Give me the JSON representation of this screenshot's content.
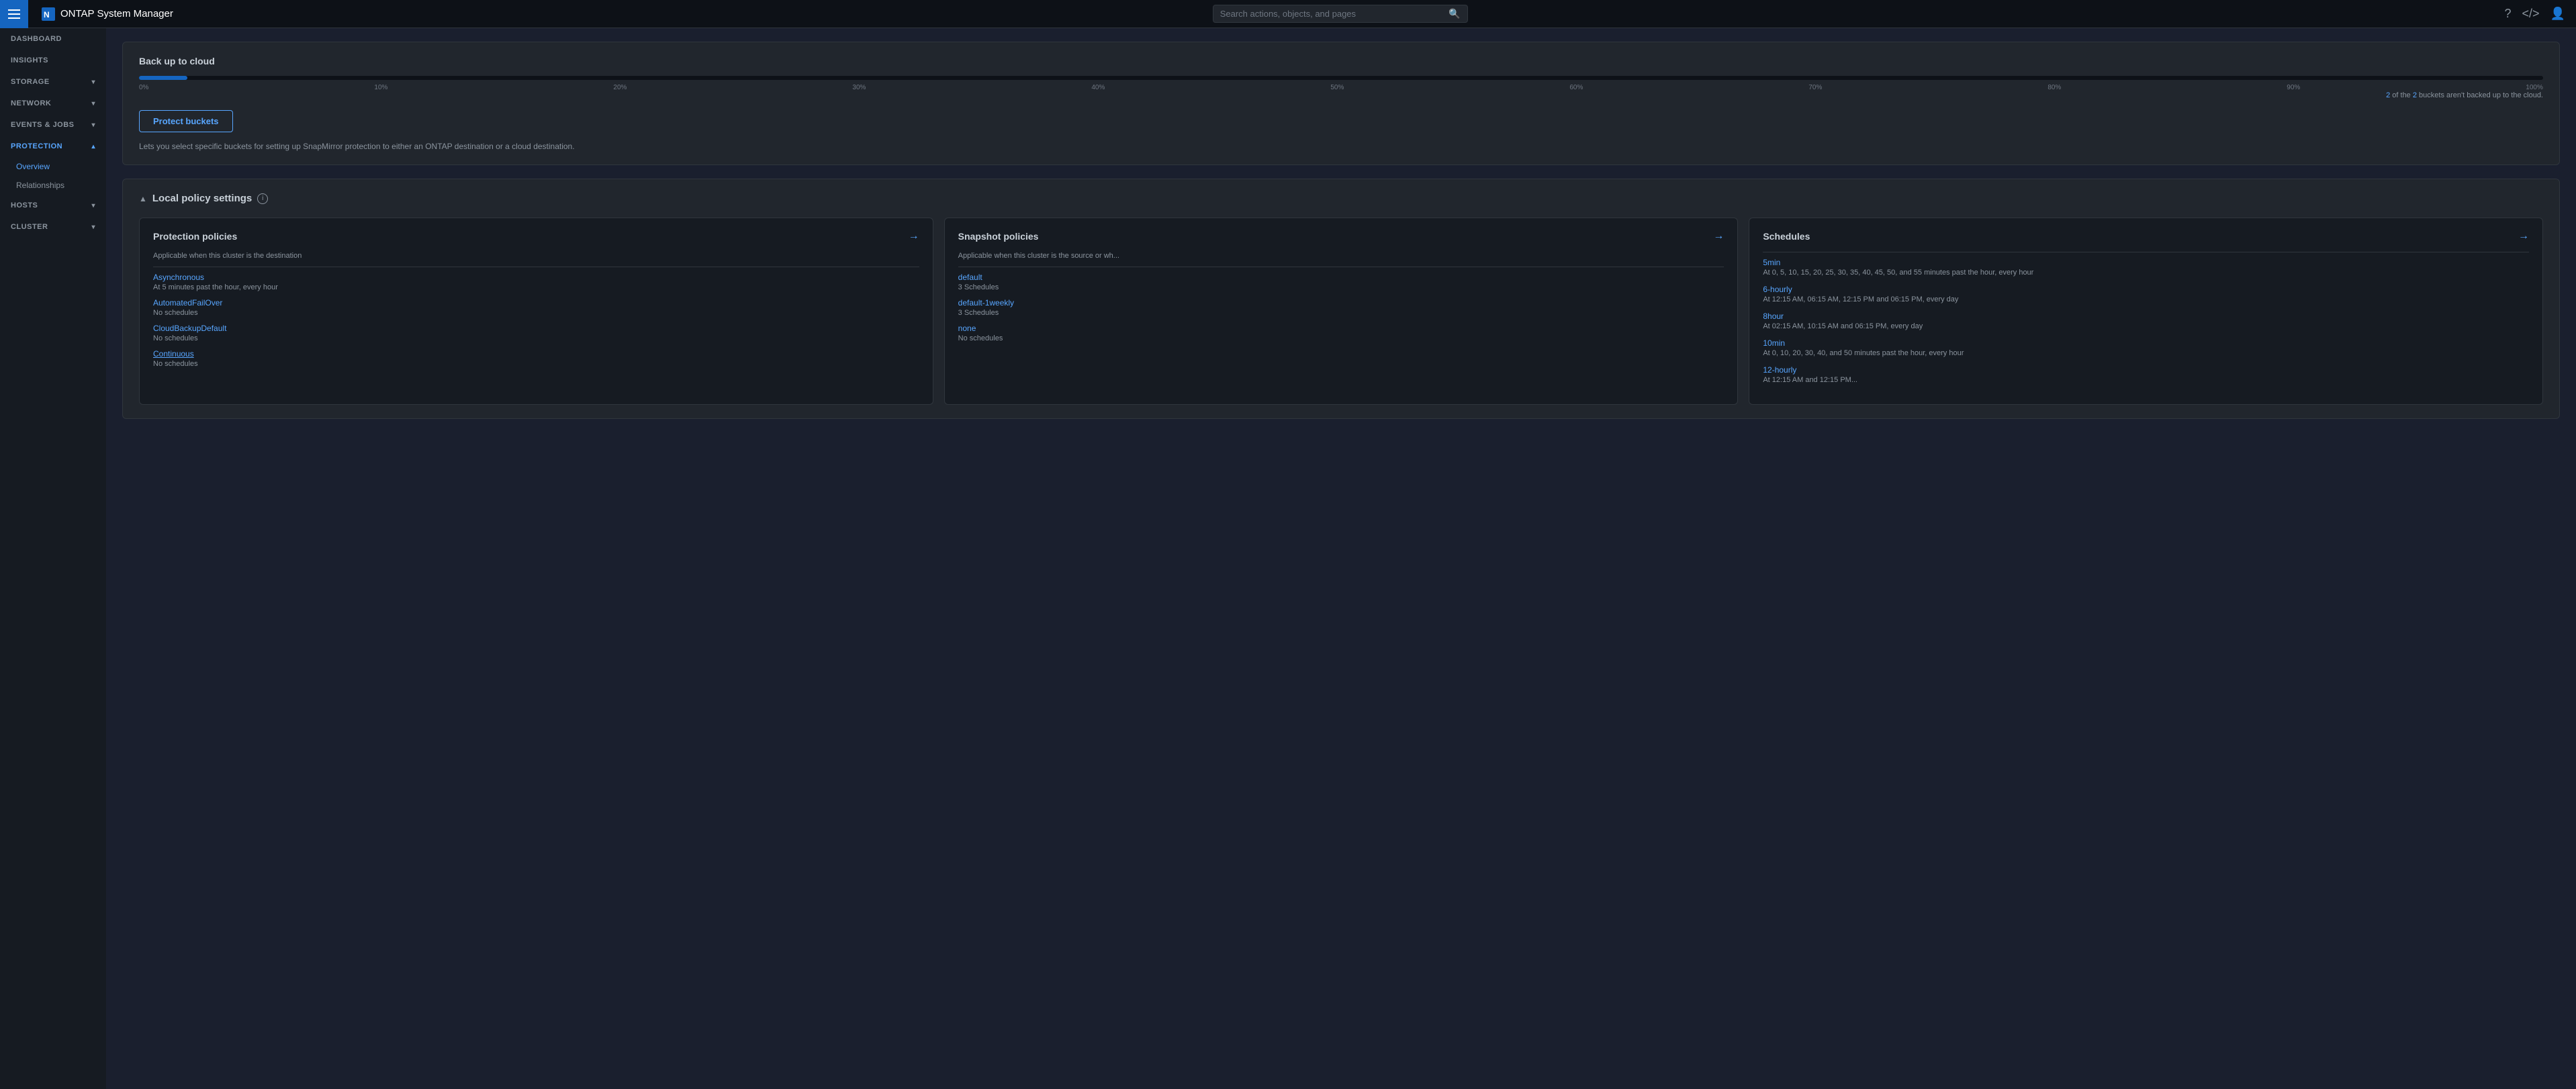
{
  "app": {
    "title": "ONTAP System Manager",
    "search_placeholder": "Search actions, objects, and pages"
  },
  "sidebar": {
    "items": [
      {
        "id": "dashboard",
        "label": "DASHBOARD",
        "has_children": false,
        "active": false
      },
      {
        "id": "insights",
        "label": "INSIGHTS",
        "has_children": false,
        "active": false
      },
      {
        "id": "storage",
        "label": "STORAGE",
        "has_children": true,
        "active": false
      },
      {
        "id": "network",
        "label": "NETWORK",
        "has_children": true,
        "active": false
      },
      {
        "id": "events-jobs",
        "label": "EVENTS & JOBS",
        "has_children": true,
        "active": false
      },
      {
        "id": "protection",
        "label": "PROTECTION",
        "has_children": true,
        "active": true
      }
    ],
    "protection_children": [
      {
        "id": "overview",
        "label": "Overview",
        "active": true
      },
      {
        "id": "relationships",
        "label": "Relationships",
        "active": false
      }
    ],
    "bottom_items": [
      {
        "id": "hosts",
        "label": "HOSTS",
        "has_children": true
      },
      {
        "id": "cluster",
        "label": "CLUSTER",
        "has_children": true
      }
    ]
  },
  "cloud_section": {
    "title": "Back up to cloud",
    "progress_note_prefix": "2 of the",
    "progress_note_count": "2",
    "progress_note_suffix": "buckets aren't backed up to the cloud.",
    "progress_percent": 2,
    "progress_labels": [
      "0%",
      "10%",
      "20%",
      "30%",
      "40%",
      "50%",
      "60%",
      "70%",
      "80%",
      "90%",
      "100%"
    ],
    "protect_btn_label": "Protect buckets",
    "protect_desc": "Lets you select specific buckets for setting up SnapMirror protection to either an ONTAP destination or a cloud destination."
  },
  "policy_section": {
    "title": "Local policy settings",
    "section_header_arrow": "▲"
  },
  "protection_policies": {
    "card_title": "Protection policies",
    "card_subtitle": "Applicable when this cluster is the destination",
    "arrow": "→",
    "policies": [
      {
        "name": "Asynchronous",
        "detail": "At 5 minutes past the hour, every hour"
      },
      {
        "name": "AutomatedFailOver",
        "detail": "No schedules"
      },
      {
        "name": "CloudBackupDefault",
        "detail": "No schedules"
      },
      {
        "name": "Continuous",
        "detail": "No schedules"
      }
    ]
  },
  "snapshot_policies": {
    "card_title": "Snapshot policies",
    "card_subtitle": "Applicable when this cluster is the source or wh...",
    "arrow": "→",
    "policies": [
      {
        "name": "default",
        "detail": "3 Schedules"
      },
      {
        "name": "default-1weekly",
        "detail": "3 Schedules"
      },
      {
        "name": "none",
        "detail": "No schedules"
      }
    ]
  },
  "schedules": {
    "card_title": "Schedules",
    "arrow": "→",
    "items": [
      {
        "name": "5min",
        "detail": "At 0, 5, 10, 15, 20, 25, 30, 35, 40, 45, 50, and 55 minutes past the hour, every hour"
      },
      {
        "name": "6-hourly",
        "detail": "At 12:15 AM, 06:15 AM, 12:15 PM and 06:15 PM, every day"
      },
      {
        "name": "8hour",
        "detail": "At 02:15 AM, 10:15 AM and 06:15 PM, every day"
      },
      {
        "name": "10min",
        "detail": "At 0, 10, 20, 30, 40, and 50 minutes past the hour, every hour"
      },
      {
        "name": "12-hourly",
        "detail": "At 12:15 AM and 12:15 PM..."
      }
    ]
  }
}
